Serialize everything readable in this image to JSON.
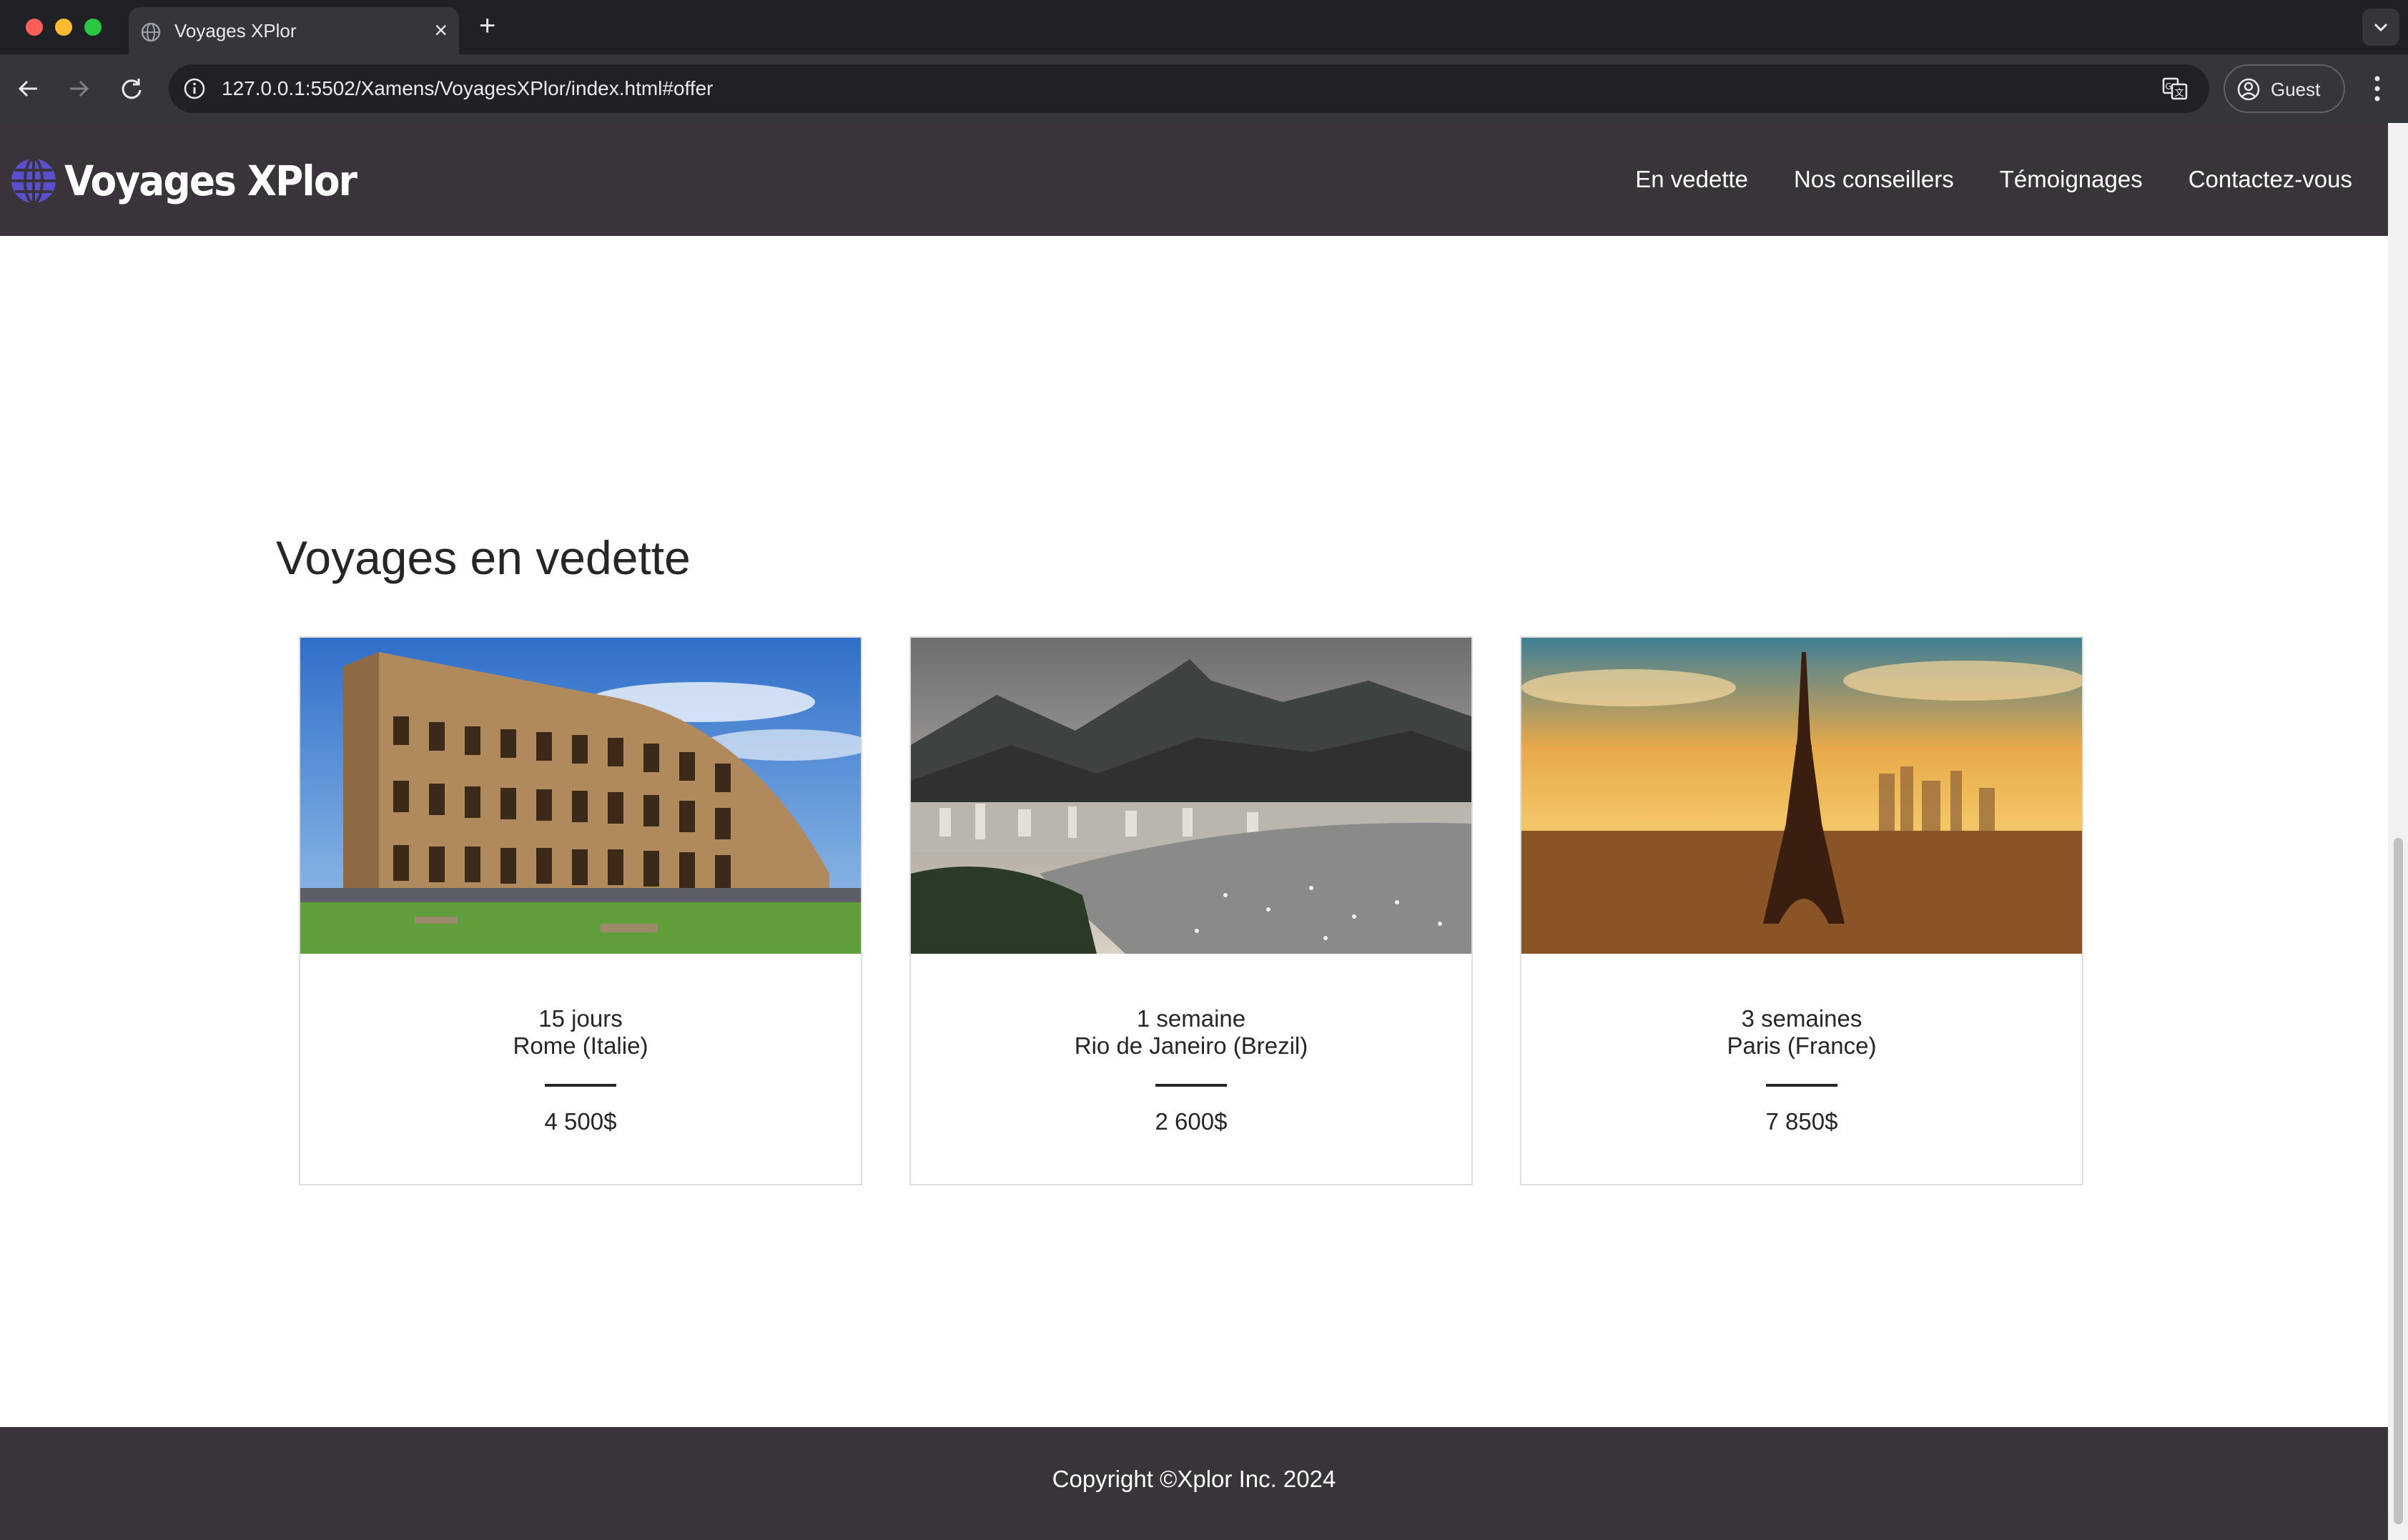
{
  "browser": {
    "tab_title": "Voyages XPlor",
    "url": "127.0.0.1:5502/Xamens/VoyagesXPlor/index.html#offer",
    "profile_label": "Guest"
  },
  "site": {
    "brand": "Voyages XPlor",
    "nav": [
      {
        "label": "En vedette"
      },
      {
        "label": "Nos conseillers"
      },
      {
        "label": "Témoignages"
      },
      {
        "label": "Contactez-vous"
      }
    ]
  },
  "offers": {
    "title": "Voyages en vedette",
    "cards": [
      {
        "duration": "15 jours",
        "city": "Rome (Italie)",
        "price": "4 500$",
        "image": "colosseum"
      },
      {
        "duration": "1 semaine",
        "city": "Rio de Janeiro (Brezil)",
        "price": "2 600$",
        "image": "rio-bay"
      },
      {
        "duration": "3 semaines",
        "city": "Paris (France)",
        "price": "7 850$",
        "image": "eiffel-tower"
      }
    ]
  },
  "footer": {
    "copyright": "Copyright ©Xplor Inc. 2024"
  },
  "colors": {
    "nav_bg": "#383439",
    "text": "#262626",
    "card_border": "#dedede",
    "brand_icon": "#5a4fcf"
  }
}
